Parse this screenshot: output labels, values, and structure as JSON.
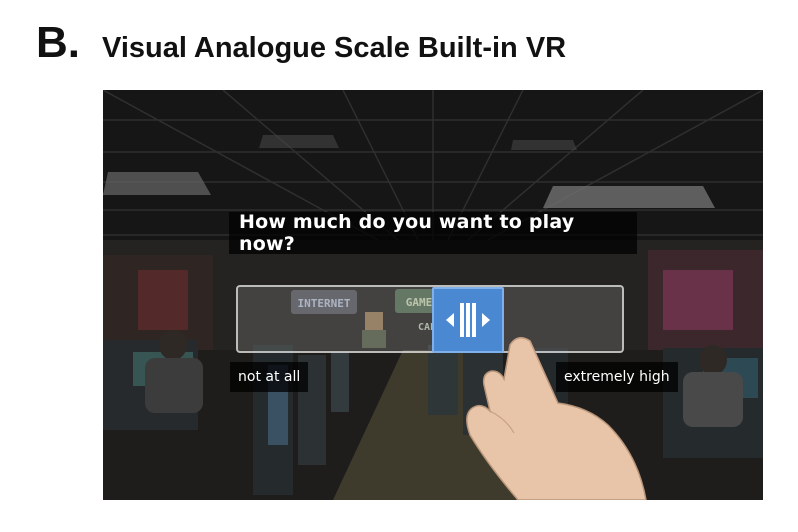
{
  "figure": {
    "panel_letter": "B.",
    "title": "Visual Analogue Scale Built-in VR"
  },
  "vas": {
    "question": "How much do you want to play now?",
    "min_label": "not at all",
    "max_label": "extremely high",
    "thumb_level": 0.62,
    "accent_color": "#4a88d2"
  },
  "background_signs": [
    "INTERNET",
    "GAME",
    "CAFE"
  ],
  "icons": [
    "thumb-left-arrow-icon",
    "thumb-grip-icon",
    "thumb-right-arrow-icon",
    "pointing-hand-icon"
  ]
}
